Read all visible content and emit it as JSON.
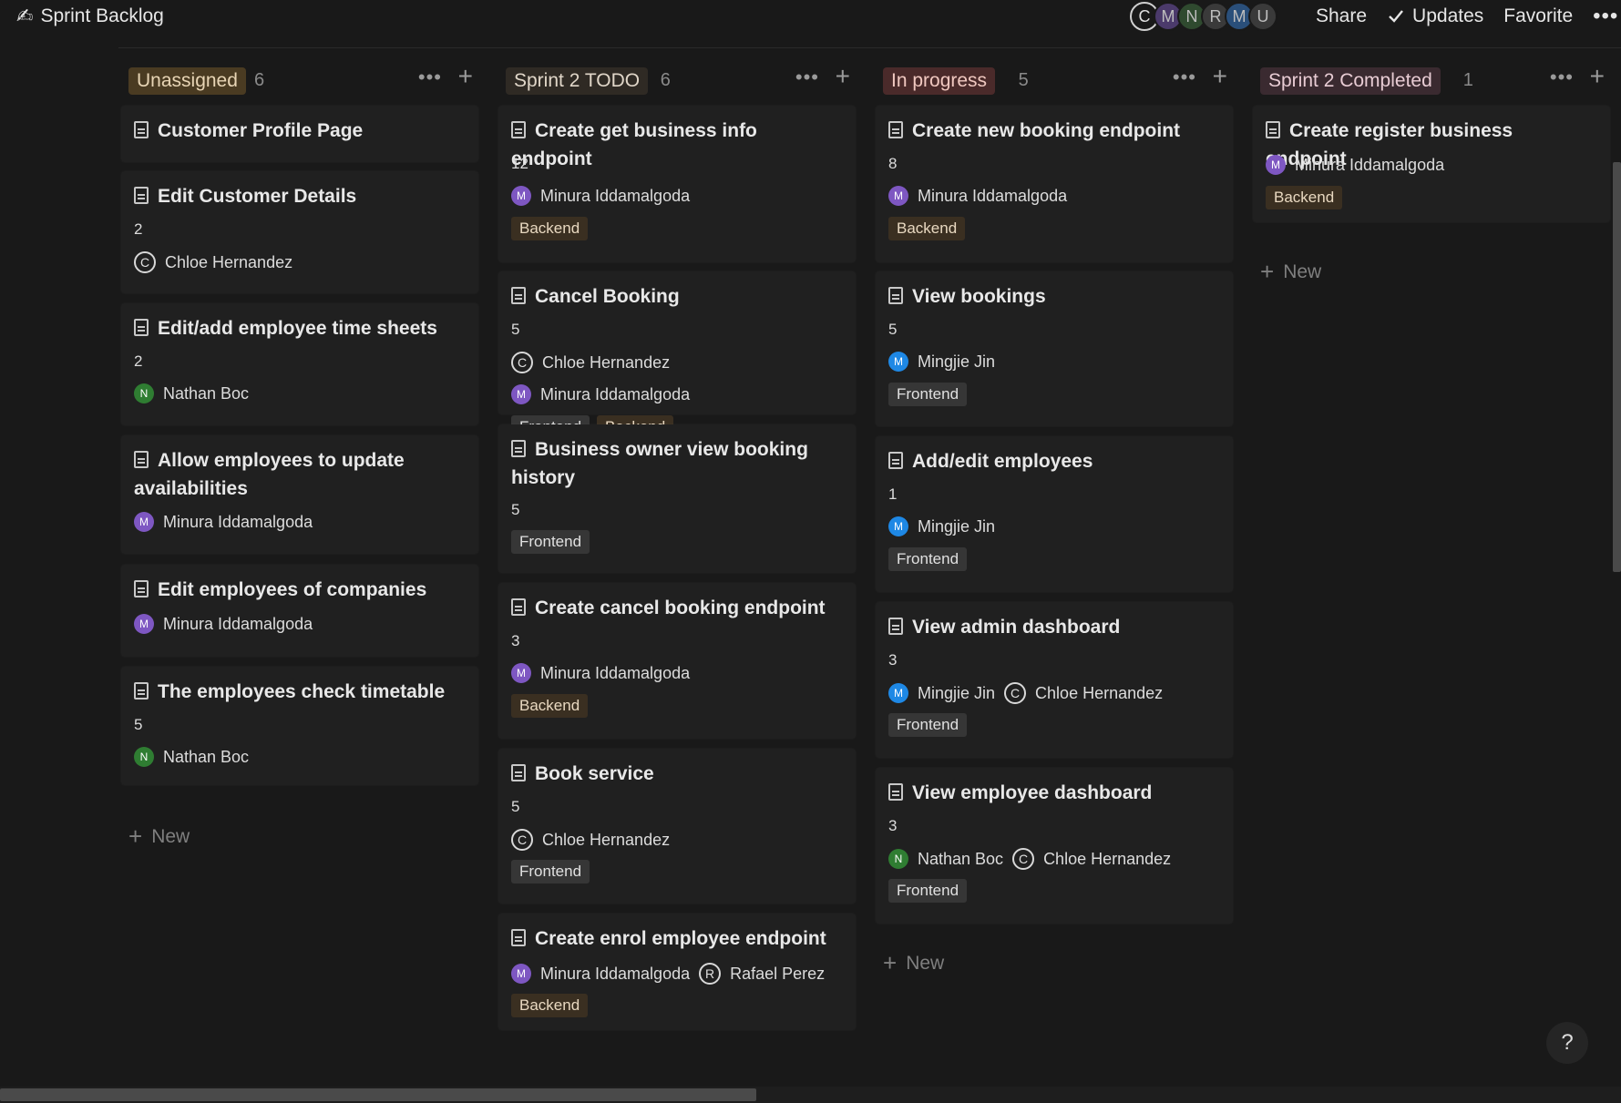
{
  "header": {
    "page_icon": "✍",
    "title": "Sprint Backlog",
    "avatars": [
      {
        "initial": "C",
        "color": "#191919",
        "style": "outline"
      },
      {
        "initial": "M",
        "color": "#4b3a6b"
      },
      {
        "initial": "N",
        "color": "#2f4a2f"
      },
      {
        "initial": "R",
        "color": "#3a3a3a"
      },
      {
        "initial": "M",
        "color": "#2a4f7a"
      },
      {
        "initial": "U",
        "color": "#3a3a3a"
      }
    ],
    "share_label": "Share",
    "updates_label": "Updates",
    "favorite_label": "Favorite",
    "more_label": "•••"
  },
  "columns": [
    {
      "name": "Unassigned",
      "count": "6",
      "pill_bg": "#4a3b22",
      "pill_fg": "#e8d5b5",
      "cards": [
        {
          "title": "Customer Profile Page",
          "points": "",
          "people": [],
          "tags": []
        },
        {
          "title": "Edit Customer Details",
          "points": "2",
          "people": [
            {
              "name": "Chloe Hernandez",
              "initial": "C",
              "color": "outline"
            }
          ],
          "tags": []
        },
        {
          "title": "Edit/add employee time sheets",
          "points": "2",
          "people": [
            {
              "name": "Nathan Boc",
              "initial": "N",
              "color": "#2f7d32"
            }
          ],
          "tags": []
        },
        {
          "title": "Allow employees to update availabilities",
          "points": "",
          "people": [
            {
              "name": "Minura Iddamalgoda",
              "initial": "M",
              "color": "#7e57c2"
            }
          ],
          "tags": []
        },
        {
          "title": "Edit employees of companies",
          "points": "",
          "people": [
            {
              "name": "Minura Iddamalgoda",
              "initial": "M",
              "color": "#7e57c2"
            }
          ],
          "tags": []
        },
        {
          "title": "The employees check timetable",
          "points": "5",
          "people": [
            {
              "name": "Nathan Boc",
              "initial": "N",
              "color": "#2f7d32"
            }
          ],
          "tags": []
        }
      ],
      "new_label": "New"
    },
    {
      "name": "Sprint 2 TODO",
      "count": "6",
      "pill_bg": "#2f2a24",
      "pill_fg": "#e0d6c8",
      "cards": [
        {
          "title": "Create get business info endpoint",
          "points": "12",
          "people": [
            {
              "name": "Minura Iddamalgoda",
              "initial": "M",
              "color": "#7e57c2"
            }
          ],
          "tags": [
            "Backend"
          ]
        },
        {
          "title": "Cancel Booking",
          "points": "5",
          "people": [
            {
              "name": "Chloe Hernandez",
              "initial": "C",
              "color": "outline"
            },
            {
              "name": "Minura Iddamalgoda",
              "initial": "M",
              "color": "#7e57c2"
            }
          ],
          "tags": [
            "Frontend",
            "Backend"
          ]
        },
        {
          "title": "Business owner view booking history",
          "points": "5",
          "people": [],
          "tags": [
            "Frontend"
          ]
        },
        {
          "title": "Create cancel booking endpoint",
          "points": "3",
          "people": [
            {
              "name": "Minura Iddamalgoda",
              "initial": "M",
              "color": "#7e57c2"
            }
          ],
          "tags": [
            "Backend"
          ]
        },
        {
          "title": "Book service",
          "points": "5",
          "people": [
            {
              "name": "Chloe Hernandez",
              "initial": "C",
              "color": "outline"
            }
          ],
          "tags": [
            "Frontend"
          ]
        },
        {
          "title": "Create enrol employee endpoint",
          "points": "",
          "people": [
            {
              "name": "Minura Iddamalgoda",
              "initial": "M",
              "color": "#7e57c2"
            },
            {
              "name": "Rafael Perez",
              "initial": "R",
              "color": "outline"
            }
          ],
          "tags": [
            "Backend"
          ]
        }
      ],
      "new_label": ""
    },
    {
      "name": "In progress",
      "count": "5",
      "pill_bg": "#4a2a2a",
      "pill_fg": "#f0c8c0",
      "cards": [
        {
          "title": "Create new booking endpoint",
          "points": "8",
          "people": [
            {
              "name": "Minura Iddamalgoda",
              "initial": "M",
              "color": "#7e57c2"
            }
          ],
          "tags": [
            "Backend"
          ]
        },
        {
          "title": "View bookings",
          "points": "5",
          "people": [
            {
              "name": "Mingjie Jin",
              "initial": "M",
              "color": "#1e88e5"
            }
          ],
          "tags": [
            "Frontend"
          ]
        },
        {
          "title": "Add/edit employees",
          "points": "1",
          "people": [
            {
              "name": "Mingjie Jin",
              "initial": "M",
              "color": "#1e88e5"
            }
          ],
          "tags": [
            "Frontend"
          ]
        },
        {
          "title": "View admin dashboard",
          "points": "3",
          "people": [
            {
              "name": "Mingjie Jin",
              "initial": "M",
              "color": "#1e88e5"
            },
            {
              "name": "Chloe Hernandez",
              "initial": "C",
              "color": "outline"
            }
          ],
          "tags": [
            "Frontend"
          ]
        },
        {
          "title": "View employee dashboard",
          "points": "3",
          "people": [
            {
              "name": "Nathan Boc",
              "initial": "N",
              "color": "#2f7d32"
            },
            {
              "name": "Chloe Hernandez",
              "initial": "C",
              "color": "outline"
            }
          ],
          "tags": [
            "Frontend"
          ]
        }
      ],
      "new_label": "New"
    },
    {
      "name": "Sprint 2 Completed",
      "count": "1",
      "pill_bg": "#3a2a30",
      "pill_fg": "#e8ccd4",
      "cards": [
        {
          "title": "Create register business endpoint",
          "points": "",
          "people": [
            {
              "name": "Minura Iddamalgoda",
              "initial": "M",
              "color": "#7e57c2"
            }
          ],
          "tags": [
            "Backend"
          ]
        }
      ],
      "new_label": "New"
    }
  ],
  "help_label": "?"
}
